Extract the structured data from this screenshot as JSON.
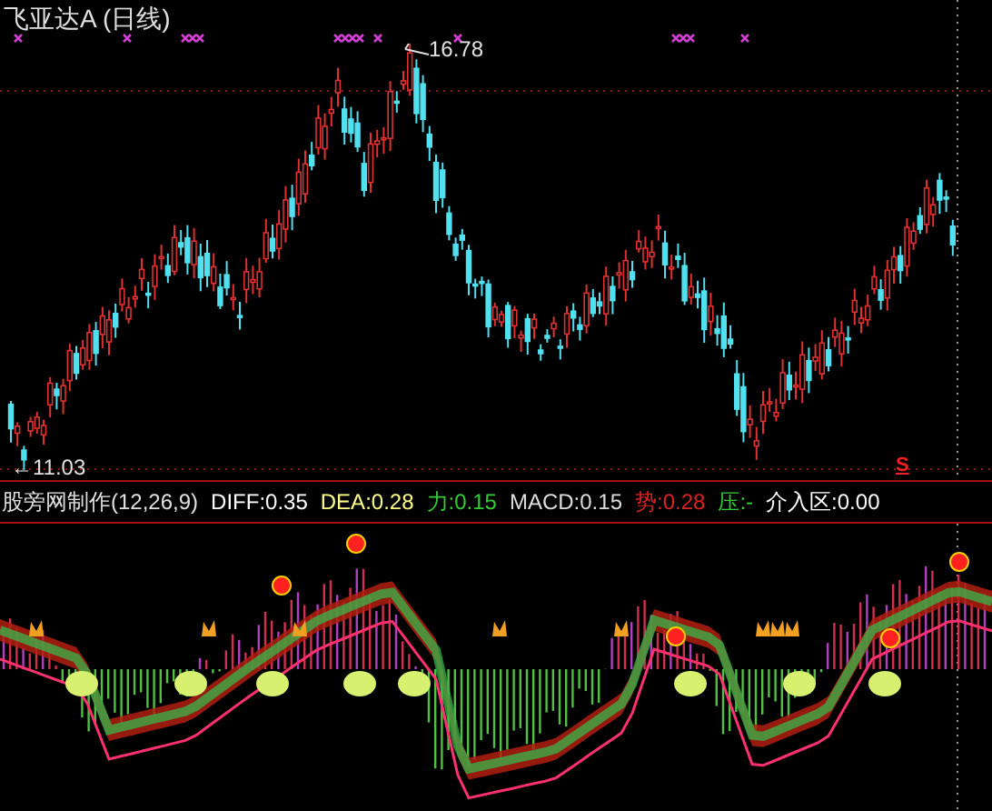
{
  "chart": {
    "title": "飞亚达A (日线)",
    "high_label": "16.78",
    "low_label": "←11.03",
    "signal_mark": "S"
  },
  "indicator": {
    "name": "股旁网制作(12,26,9)",
    "values": [
      {
        "label": "DIFF:0.35",
        "color": "#ffffff"
      },
      {
        "label": "DEA:0.28",
        "color": "#ffff88"
      },
      {
        "label": "力:0.15",
        "color": "#33cc33"
      },
      {
        "label": "MACD:0.15",
        "color": "#dddddd"
      },
      {
        "label": "势:0.28",
        "color": "#dd2222"
      },
      {
        "label": "压:-",
        "color": "#33cc33"
      },
      {
        "label": "介入区:0.00",
        "color": "#ffffff"
      }
    ]
  }
}
